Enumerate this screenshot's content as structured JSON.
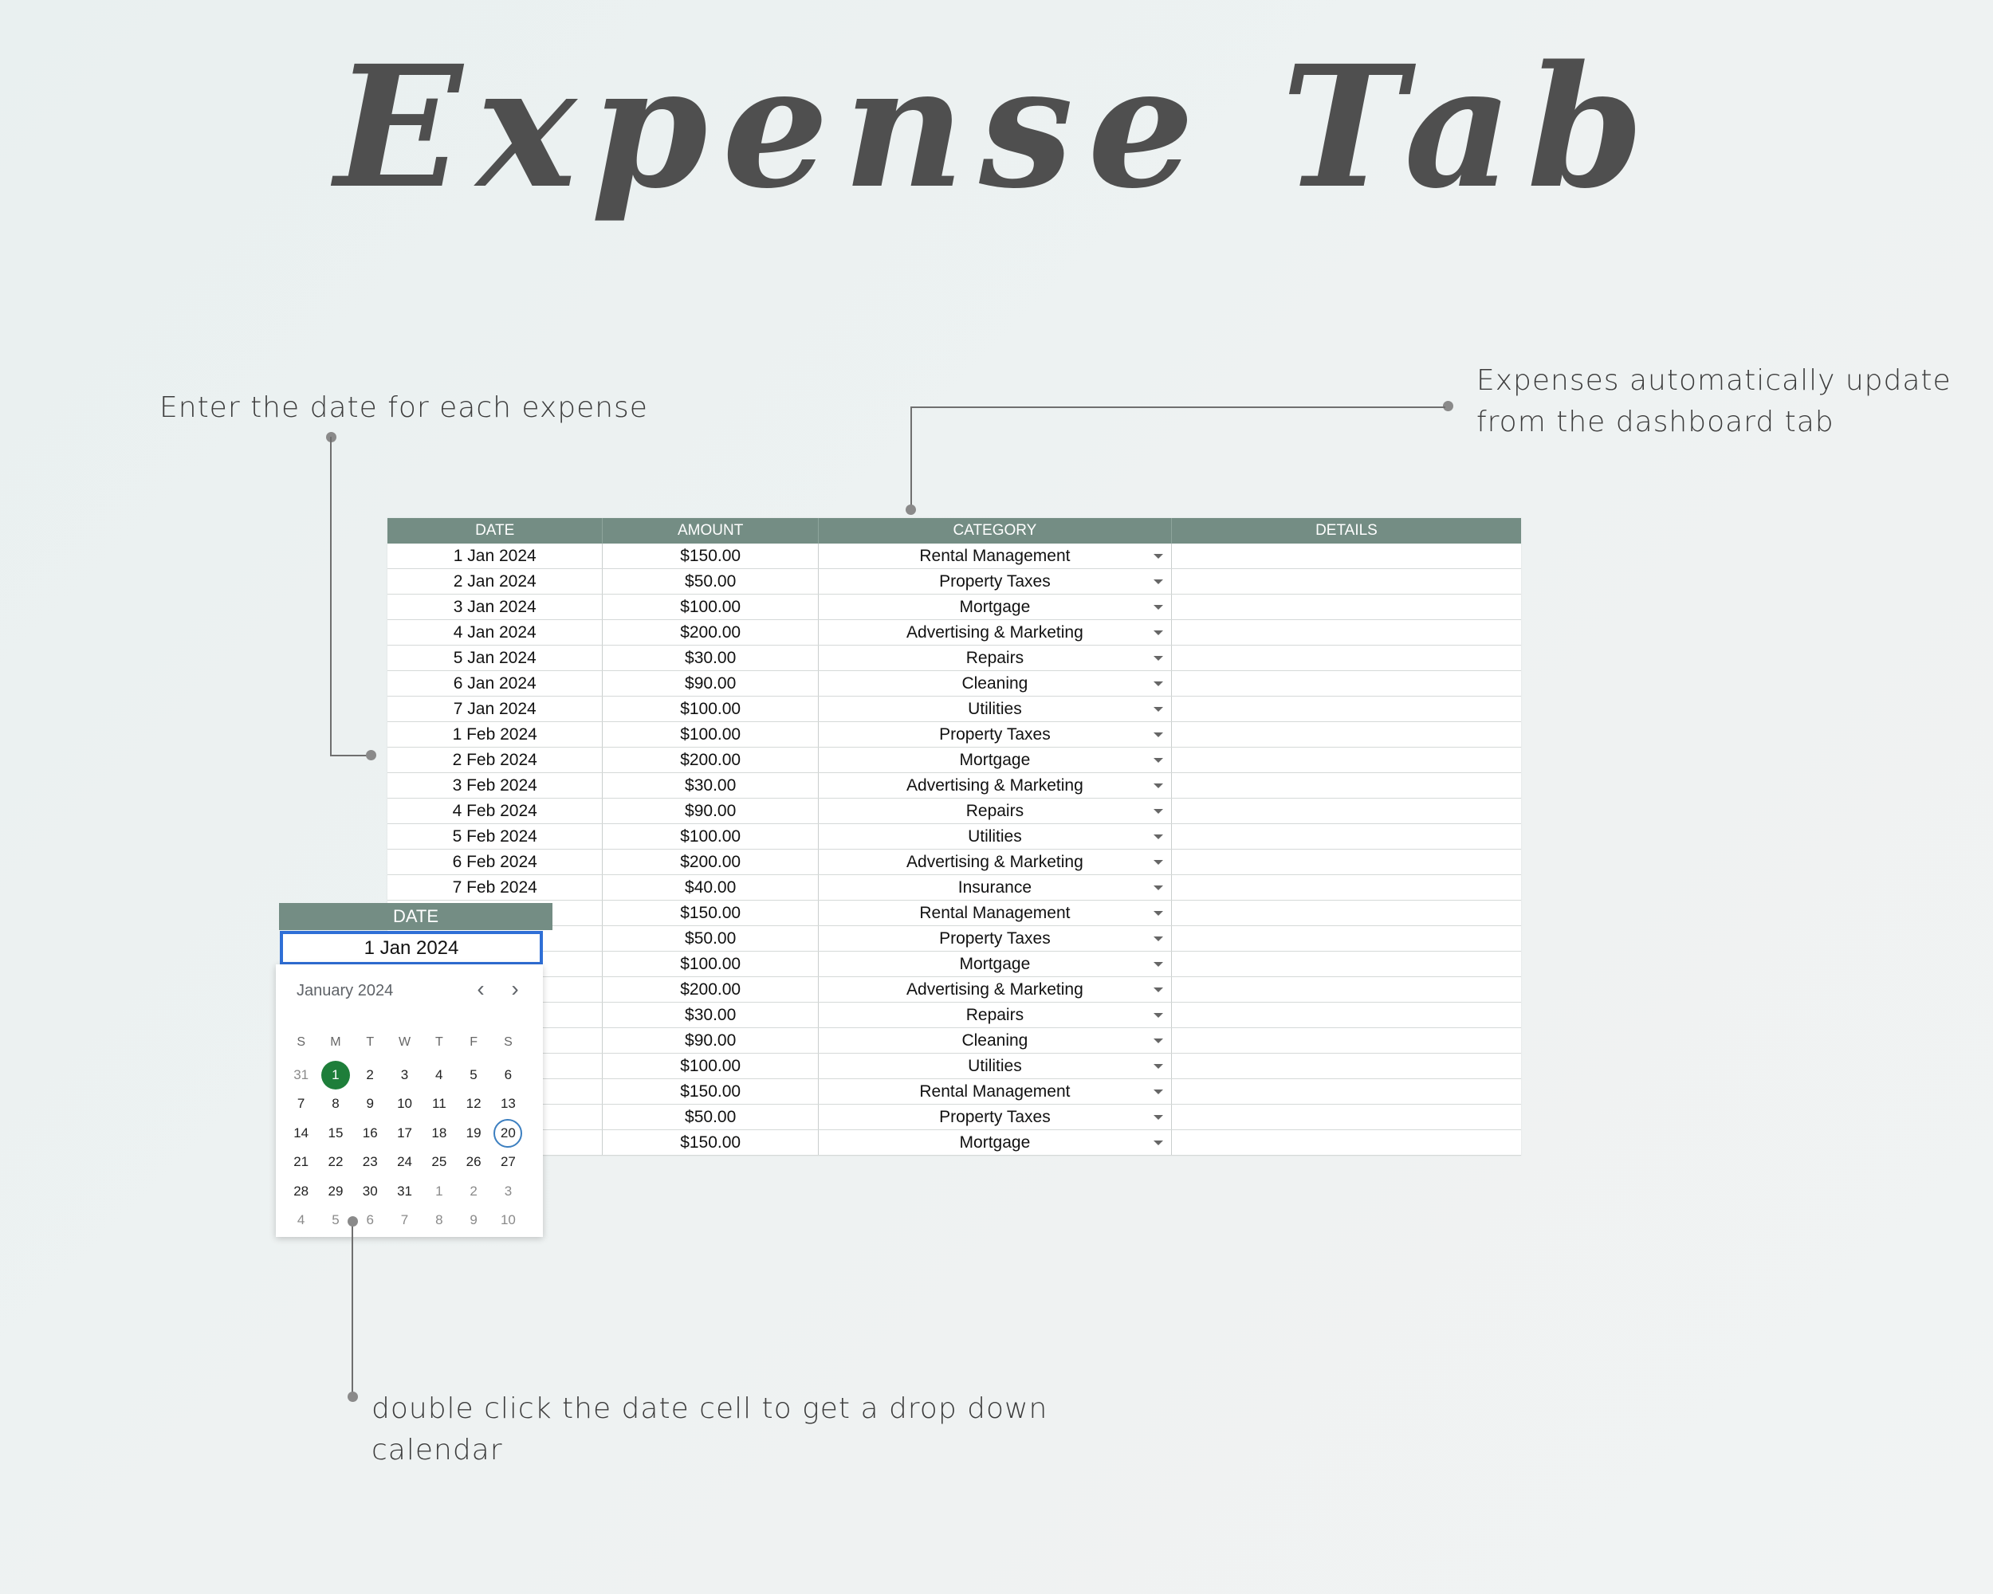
{
  "title": "Expense Tab",
  "notes": {
    "date_note": "Enter the date for each expense",
    "auto_note_line1": "Expenses automatically update",
    "auto_note_line2": "from the dashboard tab",
    "calendar_note_line1": "double click the date cell to get a drop down",
    "calendar_note_line2": "calendar"
  },
  "table": {
    "headers": [
      "DATE",
      "AMOUNT",
      "CATEGORY",
      "DETAILS"
    ],
    "rows": [
      {
        "date": "1 Jan 2024",
        "amount": "$150.00",
        "category": "Rental Management"
      },
      {
        "date": "2 Jan 2024",
        "amount": "$50.00",
        "category": "Property Taxes"
      },
      {
        "date": "3 Jan 2024",
        "amount": "$100.00",
        "category": "Mortgage"
      },
      {
        "date": "4 Jan 2024",
        "amount": "$200.00",
        "category": "Advertising & Marketing"
      },
      {
        "date": "5 Jan 2024",
        "amount": "$30.00",
        "category": "Repairs"
      },
      {
        "date": "6 Jan 2024",
        "amount": "$90.00",
        "category": "Cleaning"
      },
      {
        "date": "7 Jan 2024",
        "amount": "$100.00",
        "category": "Utilities"
      },
      {
        "date": "1 Feb 2024",
        "amount": "$100.00",
        "category": "Property Taxes"
      },
      {
        "date": "2 Feb 2024",
        "amount": "$200.00",
        "category": "Mortgage"
      },
      {
        "date": "3 Feb 2024",
        "amount": "$30.00",
        "category": "Advertising & Marketing"
      },
      {
        "date": "4 Feb 2024",
        "amount": "$90.00",
        "category": "Repairs"
      },
      {
        "date": "5 Feb 2024",
        "amount": "$100.00",
        "category": "Utilities"
      },
      {
        "date": "6 Feb 2024",
        "amount": "$200.00",
        "category": "Advertising & Marketing"
      },
      {
        "date": "7 Feb 2024",
        "amount": "$40.00",
        "category": "Insurance"
      },
      {
        "date": "",
        "amount": "$150.00",
        "category": "Rental Management"
      },
      {
        "date": "",
        "amount": "$50.00",
        "category": "Property Taxes"
      },
      {
        "date": "",
        "amount": "$100.00",
        "category": "Mortgage"
      },
      {
        "date": "",
        "amount": "$200.00",
        "category": "Advertising & Marketing"
      },
      {
        "date": "",
        "amount": "$30.00",
        "category": "Repairs"
      },
      {
        "date": "",
        "amount": "$90.00",
        "category": "Cleaning"
      },
      {
        "date": "",
        "amount": "$100.00",
        "category": "Utilities"
      },
      {
        "date": "",
        "amount": "$150.00",
        "category": "Rental Management"
      },
      {
        "date": "",
        "amount": "$50.00",
        "category": "Property Taxes"
      },
      {
        "date": "",
        "amount": "$150.00",
        "category": "Mortgage"
      }
    ]
  },
  "date_picker": {
    "header": "DATE",
    "value": "1 Jan 2024",
    "month_label": "January 2024",
    "prev_icon": "chevron-left-icon",
    "next_icon": "chevron-right-icon",
    "weekdays": [
      "S",
      "M",
      "T",
      "W",
      "T",
      "F",
      "S"
    ],
    "weeks": [
      [
        "31",
        "1",
        "2",
        "3",
        "4",
        "5",
        "6"
      ],
      [
        "7",
        "8",
        "9",
        "10",
        "11",
        "12",
        "13"
      ],
      [
        "14",
        "15",
        "16",
        "17",
        "18",
        "19",
        "20"
      ],
      [
        "21",
        "22",
        "23",
        "24",
        "25",
        "26",
        "27"
      ],
      [
        "28",
        "29",
        "30",
        "31",
        "1",
        "2",
        "3"
      ],
      [
        "4",
        "5",
        "6",
        "7",
        "8",
        "9",
        "10"
      ]
    ],
    "selected_day": "1",
    "today_day": "20",
    "selected_color": "#1e7e3a",
    "today_color": "#3c7fc0"
  },
  "colors": {
    "header_bg": "#748d84",
    "selection_border": "#2f6fd6"
  }
}
